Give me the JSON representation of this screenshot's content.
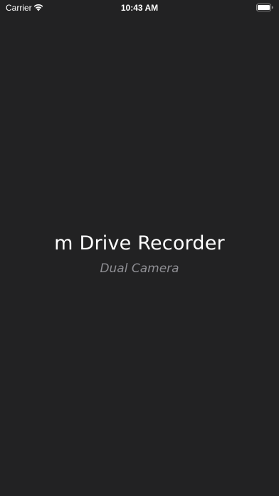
{
  "status_bar": {
    "carrier": "Carrier",
    "time": "10:43 AM",
    "wifi_icon": "wifi-icon",
    "battery_icon": "battery-icon"
  },
  "splash": {
    "title": "m Drive Recorder",
    "subtitle": "Dual Camera"
  },
  "colors": {
    "background": "#222223",
    "title": "#ffffff",
    "subtitle": "#8e8e93"
  }
}
